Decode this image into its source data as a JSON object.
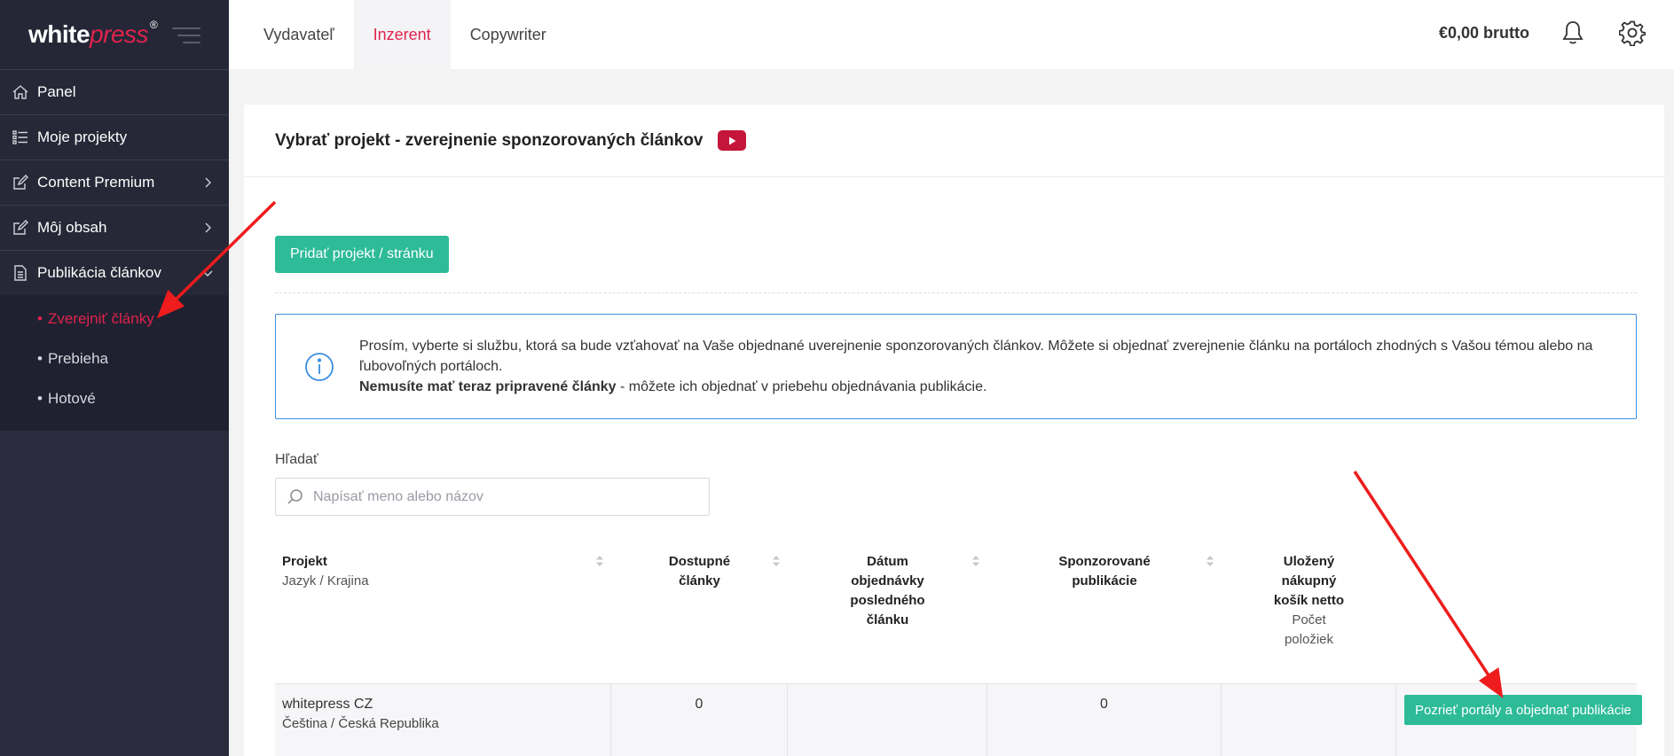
{
  "brand": {
    "white": "white",
    "press": "press",
    "reg": "®"
  },
  "sidebar": {
    "items": [
      {
        "label": "Panel",
        "icon": "home-icon"
      },
      {
        "label": "Moje projekty",
        "icon": "list-icon"
      },
      {
        "label": "Content Premium",
        "icon": "edit-icon"
      },
      {
        "label": "Môj obsah",
        "icon": "edit-icon"
      },
      {
        "label": "Publikácia článkov",
        "icon": "document-icon"
      }
    ],
    "subitems": [
      {
        "label": "Zverejniť články",
        "active": true
      },
      {
        "label": "Prebieha",
        "active": false
      },
      {
        "label": "Hotové",
        "active": false
      }
    ]
  },
  "topbar": {
    "tabs": [
      "Vydavateľ",
      "Inzerent",
      "Copywriter"
    ],
    "active_tab": "Inzerent",
    "balance": "€0,00 brutto"
  },
  "main": {
    "title": "Vybrať projekt - zverejnenie sponzorovaných článkov",
    "add_button": "Pridať projekt / stránku",
    "info": {
      "text": "Prosím, vyberte si službu, ktorá sa bude vzťahovať na Vaše objednané uverejnenie sponzorovaných článkov. Môžete si objednať zverejnenie článku na portáloch zhodných s Vašou témou alebo na ľubovoľných portáloch.",
      "bold": "Nemusíte mať teraz pripravené články",
      "rest": " - môžete ich objednať v priebehu objednávania publikácie."
    },
    "search": {
      "label": "Hľadať",
      "placeholder": "Napísať meno alebo názov"
    },
    "table": {
      "headers": {
        "project": "Projekt",
        "project_sub": "Jazyk / Krajina",
        "available": "Dostupné články",
        "last_order": "Dátum objednávky posledného článku",
        "sponsored": "Sponzorované publikácie",
        "cart": "Uložený nákupný košík netto",
        "cart_sub": "Počet položiek"
      },
      "rows": [
        {
          "project": "whitepress CZ",
          "lang": "Čeština / Česká Republika",
          "available": "0",
          "last_order": "",
          "sponsored": "0",
          "cart": "",
          "action": "Pozrieť portály a objednať publikácie"
        }
      ]
    }
  },
  "colors": {
    "accent": "#e0234d",
    "button": "#2dbb98",
    "sidebar": "#2a2c3d",
    "info_border": "#3a8fe0"
  }
}
